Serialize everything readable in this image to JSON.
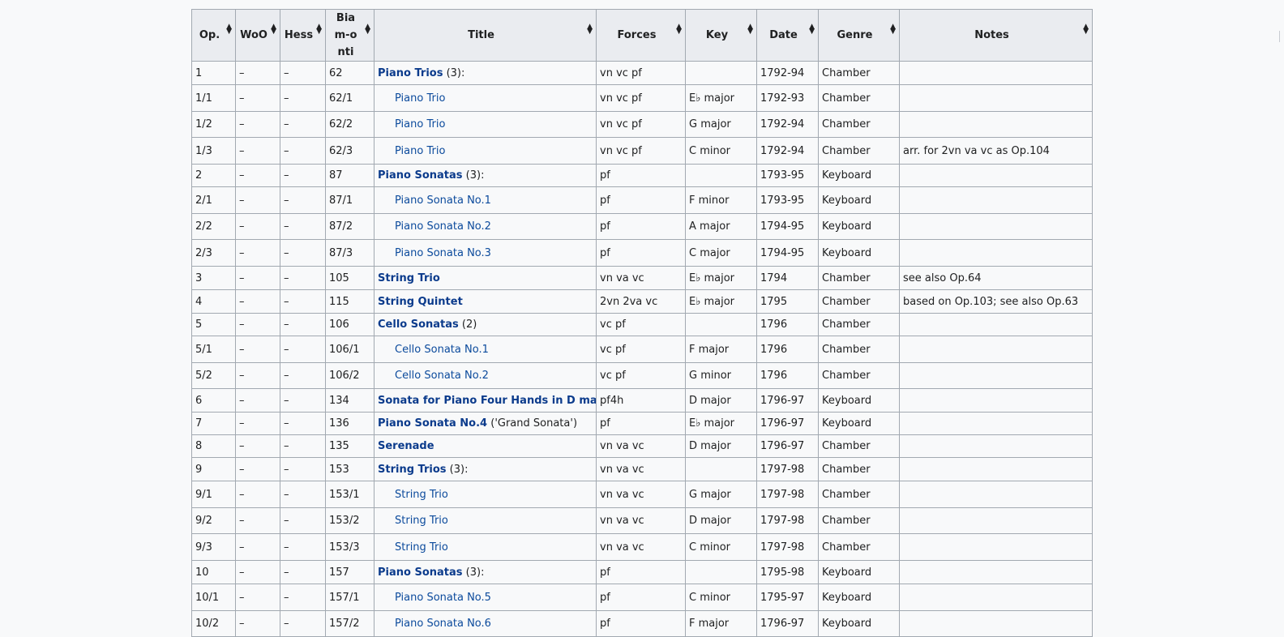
{
  "columns": [
    {
      "label": "Op."
    },
    {
      "label": "WoO"
    },
    {
      "label": "Hess"
    },
    {
      "label": "Biam-onti"
    },
    {
      "label": "Title"
    },
    {
      "label": "Forces"
    },
    {
      "label": "Key"
    },
    {
      "label": "Date"
    },
    {
      "label": "Genre"
    },
    {
      "label": "Notes"
    }
  ],
  "sort_icon": "sort-updown-icon",
  "colors": {
    "link": "#0645ad",
    "header_bg": "#eaecf0",
    "border": "#a2a9b1",
    "page_bg": "#f8f9fa"
  },
  "rows": [
    {
      "kind": "parent",
      "op": "1",
      "woo": "–",
      "hess": "–",
      "biamonti": "62",
      "title_link": "Piano Trios",
      "title_suffix": " (3):",
      "forces": "vn vc pf",
      "key": "",
      "date": "1792-94",
      "genre": "Chamber",
      "notes": ""
    },
    {
      "kind": "sub",
      "op": "1/1",
      "woo": "–",
      "hess": "–",
      "biamonti": "62/1",
      "title_link": "Piano Trio",
      "title_suffix": "",
      "forces": "vn vc pf",
      "key": "E♭ major",
      "date": "1792-93",
      "genre": "Chamber",
      "notes": ""
    },
    {
      "kind": "sub",
      "op": "1/2",
      "woo": "–",
      "hess": "–",
      "biamonti": "62/2",
      "title_link": "Piano Trio",
      "title_suffix": "",
      "forces": "vn vc pf",
      "key": "G major",
      "date": "1792-94",
      "genre": "Chamber",
      "notes": ""
    },
    {
      "kind": "sub",
      "op": "1/3",
      "woo": "–",
      "hess": "–",
      "biamonti": "62/3",
      "title_link": "Piano Trio",
      "title_suffix": "",
      "forces": "vn vc pf",
      "key": "C minor",
      "date": "1792-94",
      "genre": "Chamber",
      "notes": "arr. for 2vn va vc as Op.104"
    },
    {
      "kind": "parent",
      "op": "2",
      "woo": "–",
      "hess": "–",
      "biamonti": "87",
      "title_link": "Piano Sonatas",
      "title_suffix": " (3):",
      "forces": "pf",
      "key": "",
      "date": "1793-95",
      "genre": "Keyboard",
      "notes": ""
    },
    {
      "kind": "sub",
      "op": "2/1",
      "woo": "–",
      "hess": "–",
      "biamonti": "87/1",
      "title_link": "Piano Sonata No.1",
      "title_suffix": "",
      "forces": "pf",
      "key": "F minor",
      "date": "1793-95",
      "genre": "Keyboard",
      "notes": ""
    },
    {
      "kind": "sub",
      "op": "2/2",
      "woo": "–",
      "hess": "–",
      "biamonti": "87/2",
      "title_link": "Piano Sonata No.2",
      "title_suffix": "",
      "forces": "pf",
      "key": "A major",
      "date": "1794-95",
      "genre": "Keyboard",
      "notes": ""
    },
    {
      "kind": "sub",
      "op": "2/3",
      "woo": "–",
      "hess": "–",
      "biamonti": "87/3",
      "title_link": "Piano Sonata No.3",
      "title_suffix": "",
      "forces": "pf",
      "key": "C major",
      "date": "1794-95",
      "genre": "Keyboard",
      "notes": ""
    },
    {
      "kind": "single",
      "op": "3",
      "woo": "–",
      "hess": "–",
      "biamonti": "105",
      "title_link": "String Trio",
      "title_suffix": "",
      "forces": "vn va vc",
      "key": "E♭ major",
      "date": "1794",
      "genre": "Chamber",
      "notes": "see also Op.64"
    },
    {
      "kind": "single",
      "op": "4",
      "woo": "–",
      "hess": "–",
      "biamonti": "115",
      "title_link": "String Quintet",
      "title_suffix": "",
      "forces": "2vn 2va vc",
      "key": "E♭ major",
      "date": "1795",
      "genre": "Chamber",
      "notes": "based on Op.103; see also Op.63"
    },
    {
      "kind": "parent",
      "op": "5",
      "woo": "–",
      "hess": "–",
      "biamonti": "106",
      "title_link": "Cello Sonatas",
      "title_suffix": " (2)",
      "forces": "vc pf",
      "key": "",
      "date": "1796",
      "genre": "Chamber",
      "notes": ""
    },
    {
      "kind": "sub",
      "op": "5/1",
      "woo": "–",
      "hess": "–",
      "biamonti": "106/1",
      "title_link": "Cello Sonata No.1",
      "title_suffix": "",
      "forces": "vc pf",
      "key": "F major",
      "date": "1796",
      "genre": "Chamber",
      "notes": ""
    },
    {
      "kind": "sub",
      "op": "5/2",
      "woo": "–",
      "hess": "–",
      "biamonti": "106/2",
      "title_link": "Cello Sonata No.2",
      "title_suffix": "",
      "forces": "vc pf",
      "key": "G minor",
      "date": "1796",
      "genre": "Chamber",
      "notes": ""
    },
    {
      "kind": "single",
      "op": "6",
      "woo": "–",
      "hess": "–",
      "biamonti": "134",
      "title_link": "Sonata for Piano Four Hands in D major",
      "title_suffix": "",
      "forces": "pf4h",
      "key": "D major",
      "date": "1796-97",
      "genre": "Keyboard",
      "notes": ""
    },
    {
      "kind": "single",
      "op": "7",
      "woo": "–",
      "hess": "–",
      "biamonti": "136",
      "title_link": "Piano Sonata No.4",
      "title_suffix": " ('Grand Sonata')",
      "forces": "pf",
      "key": "E♭ major",
      "date": "1796-97",
      "genre": "Keyboard",
      "notes": ""
    },
    {
      "kind": "single",
      "op": "8",
      "woo": "–",
      "hess": "–",
      "biamonti": "135",
      "title_link": "Serenade",
      "title_suffix": "",
      "forces": "vn va vc",
      "key": "D major",
      "date": "1796-97",
      "genre": "Chamber",
      "notes": ""
    },
    {
      "kind": "parent",
      "op": "9",
      "woo": "–",
      "hess": "–",
      "biamonti": "153",
      "title_link": "String Trios",
      "title_suffix": " (3):",
      "forces": "vn va vc",
      "key": "",
      "date": "1797-98",
      "genre": "Chamber",
      "notes": ""
    },
    {
      "kind": "sub",
      "op": "9/1",
      "woo": "–",
      "hess": "–",
      "biamonti": "153/1",
      "title_link": "String Trio",
      "title_suffix": "",
      "forces": "vn va vc",
      "key": "G major",
      "date": "1797-98",
      "genre": "Chamber",
      "notes": ""
    },
    {
      "kind": "sub",
      "op": "9/2",
      "woo": "–",
      "hess": "–",
      "biamonti": "153/2",
      "title_link": "String Trio",
      "title_suffix": "",
      "forces": "vn va vc",
      "key": "D major",
      "date": "1797-98",
      "genre": "Chamber",
      "notes": ""
    },
    {
      "kind": "sub",
      "op": "9/3",
      "woo": "–",
      "hess": "–",
      "biamonti": "153/3",
      "title_link": "String Trio",
      "title_suffix": "",
      "forces": "vn va vc",
      "key": "C minor",
      "date": "1797-98",
      "genre": "Chamber",
      "notes": ""
    },
    {
      "kind": "parent",
      "op": "10",
      "woo": "–",
      "hess": "–",
      "biamonti": "157",
      "title_link": "Piano Sonatas",
      "title_suffix": " (3):",
      "forces": "pf",
      "key": "",
      "date": "1795-98",
      "genre": "Keyboard",
      "notes": ""
    },
    {
      "kind": "sub",
      "op": "10/1",
      "woo": "–",
      "hess": "–",
      "biamonti": "157/1",
      "title_link": "Piano Sonata No.5",
      "title_suffix": "",
      "forces": "pf",
      "key": "C minor",
      "date": "1795-97",
      "genre": "Keyboard",
      "notes": ""
    },
    {
      "kind": "sub",
      "op": "10/2",
      "woo": "–",
      "hess": "–",
      "biamonti": "157/2",
      "title_link": "Piano Sonata No.6",
      "title_suffix": "",
      "forces": "pf",
      "key": "F major",
      "date": "1796-97",
      "genre": "Keyboard",
      "notes": ""
    }
  ]
}
